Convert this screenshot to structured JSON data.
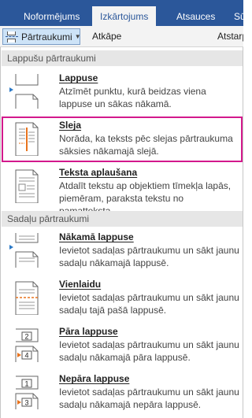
{
  "ribbon": {
    "tabs": [
      {
        "label": "Noformējums",
        "active": false
      },
      {
        "label": "Izkārtojums",
        "active": true
      },
      {
        "label": "Atsauces",
        "active": false
      },
      {
        "label": "Sū",
        "active": false
      }
    ]
  },
  "toolbar": {
    "breaks_button": "Pārtraukumi",
    "indent_label": "Atkāpe",
    "spacing_label": "Atstarp"
  },
  "menu": {
    "page_section": "Lappušu pārtraukumi",
    "section_section": "Sadaļu pārtraukumi",
    "items": [
      {
        "title": "Lappuse",
        "desc": "Atzīmēt punktu, kurā beidzas viena lappuse un sākas nākamā.",
        "icon": "page-break-icon"
      },
      {
        "title": "Sleja",
        "desc": "Norāda, ka teksts pēc slejas pārtraukuma sāksies nākamajā slejā.",
        "icon": "column-break-icon",
        "highlighted": true
      },
      {
        "title": "Teksta aplaušana",
        "desc": "Atdalīt tekstu ap objektiem tīmekļa lapās, piemēram, paraksta tekstu no pamatteksta.",
        "icon": "text-wrapping-icon"
      },
      {
        "title": "Nākamā lappuse",
        "desc": "Ievietot sadaļas pārtraukumu un sākt jaunu sadaļu nākamajā lappusē.",
        "icon": "next-page-icon"
      },
      {
        "title": "Vienlaidu",
        "desc": "Ievietot sadaļas pārtraukumu un sākt jaunu sadaļu tajā pašā lappusē.",
        "icon": "continuous-icon"
      },
      {
        "title": "Pāra lappuse",
        "desc": "Ievietot sadaļas pārtraukumu un sākt jaunu sadaļu nākamajā pāra lappusē.",
        "icon": "even-page-icon",
        "badges": [
          "2",
          "4"
        ]
      },
      {
        "title": "Nepāra lappuse",
        "desc": "Ievietot sadaļas pārtraukumu un sākt jaunu sadaļu nākamajā nepāra lappusē.",
        "icon": "odd-page-icon",
        "badges": [
          "1",
          "3"
        ]
      }
    ]
  },
  "colors": {
    "ribbon": "#2b579a",
    "accent_orange": "#e8731e",
    "highlight": "#d3198c"
  }
}
